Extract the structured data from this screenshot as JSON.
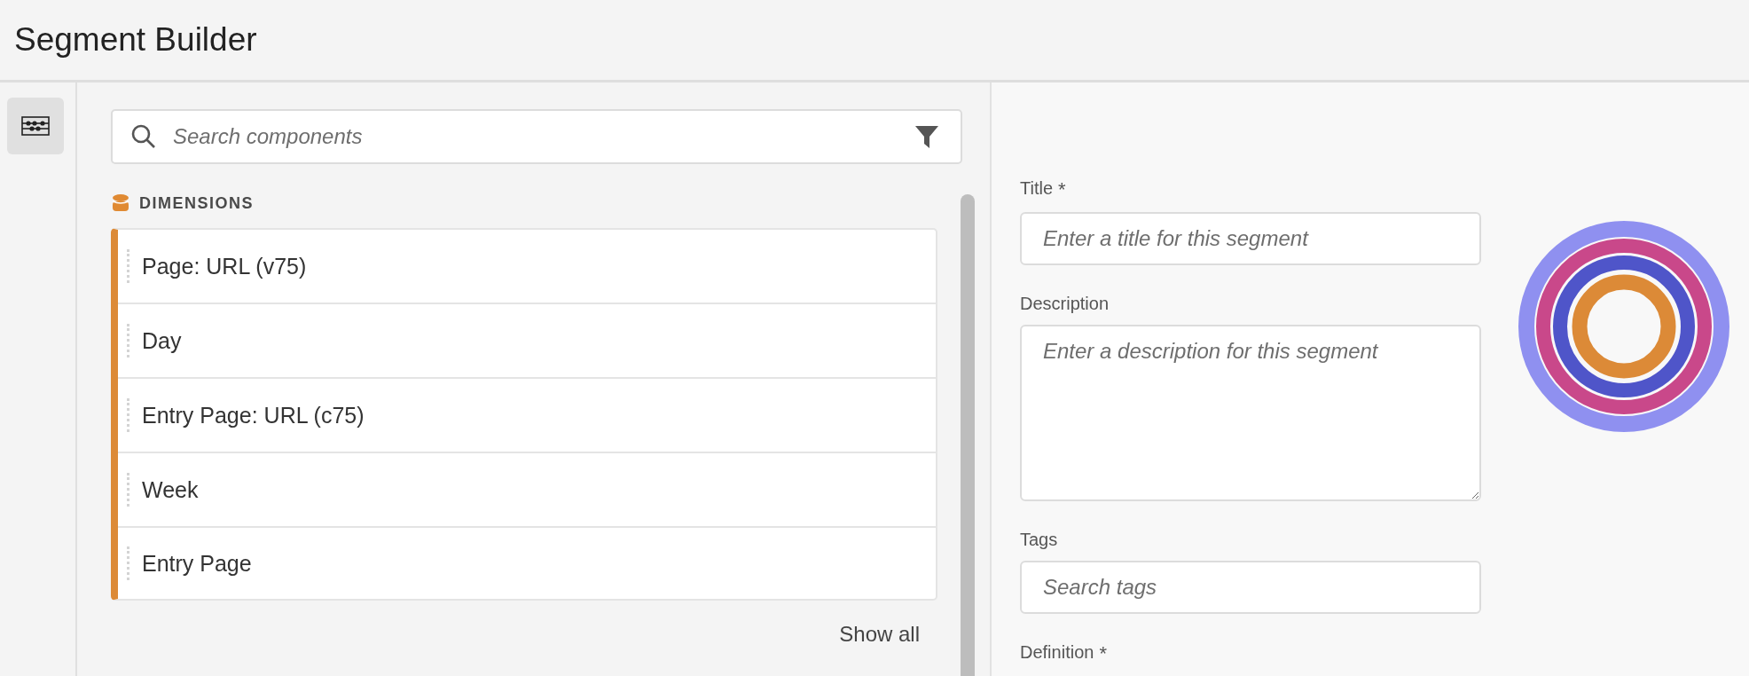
{
  "header": {
    "title": "Segment Builder"
  },
  "rail": {
    "items": [
      {
        "selected": true
      }
    ]
  },
  "components": {
    "search": {
      "placeholder": "Search components"
    },
    "section": {
      "title": "DIMENSIONS",
      "items": [
        {
          "label": "Page: URL (v75)"
        },
        {
          "label": "Day"
        },
        {
          "label": "Entry Page: URL (c75)"
        },
        {
          "label": "Week"
        },
        {
          "label": "Entry Page"
        }
      ]
    },
    "show_all": "Show all"
  },
  "form": {
    "title": {
      "label": "Title",
      "required_mark": "*",
      "placeholder": "Enter a title for this segment"
    },
    "description": {
      "label": "Description",
      "placeholder": "Enter a description for this segment"
    },
    "tags": {
      "label": "Tags",
      "placeholder": "Search tags"
    },
    "definition": {
      "label": "Definition",
      "required_mark": "*"
    }
  }
}
